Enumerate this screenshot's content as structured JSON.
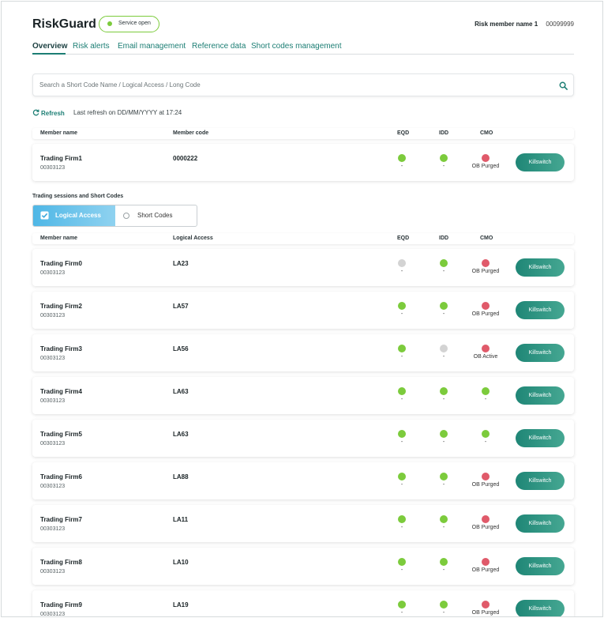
{
  "header": {
    "brand": "RiskGuard",
    "service_status": "Service open",
    "member_name": "Risk member name 1",
    "member_code": "00099999"
  },
  "colors": {
    "accent": "#1c7e74",
    "status_green": "#7ccb3c",
    "status_grey": "#d3d3d3",
    "status_red": "#e05a6a",
    "toggle_blue": "#4fb7e6"
  },
  "tabs": [
    "Overview",
    "Risk alerts",
    "Email management",
    "Reference data",
    "Short codes management"
  ],
  "search": {
    "placeholder": "Search a Short Code Name / Logical Access / Long Code",
    "icon": "search-icon"
  },
  "refresh": {
    "label": "Refresh",
    "last_refresh": "Last refresh on DD/MM/YYYY at 17:24"
  },
  "member_table": {
    "headers": {
      "name": "Member name",
      "code": "Member code",
      "eqd": "EQD",
      "idd": "IDD",
      "cmo": "CMO"
    },
    "rows": [
      {
        "name": "Trading Firm1",
        "sub": "00303123",
        "code": "0000222",
        "eqd": {
          "status": "green",
          "label": "-"
        },
        "idd": {
          "status": "green",
          "label": "-"
        },
        "cmo": {
          "status": "red",
          "label": "OB Purged"
        },
        "button": "Killswitch"
      }
    ]
  },
  "section_label": "Trading sessions and Short Codes",
  "toggle": {
    "options": [
      "Logical Access",
      "Short Codes"
    ],
    "selected": "Logical Access"
  },
  "la_table": {
    "headers": {
      "name": "Member name",
      "code": "Logical Access",
      "eqd": "EQD",
      "idd": "IDD",
      "cmo": "CMO"
    },
    "rows": [
      {
        "name": "Trading Firm0",
        "sub": "00303123",
        "code": "LA23",
        "eqd": {
          "status": "grey",
          "label": "-"
        },
        "idd": {
          "status": "green",
          "label": "-"
        },
        "cmo": {
          "status": "red",
          "label": "OB Purged"
        },
        "button": "Killswitch"
      },
      {
        "name": "Trading Firm2",
        "sub": "00303123",
        "code": "LA57",
        "eqd": {
          "status": "green",
          "label": "-"
        },
        "idd": {
          "status": "green",
          "label": "-"
        },
        "cmo": {
          "status": "red",
          "label": "OB Purged"
        },
        "button": "Killswitch"
      },
      {
        "name": "Trading Firm3",
        "sub": "00303123",
        "code": "LA56",
        "eqd": {
          "status": "green",
          "label": "-"
        },
        "idd": {
          "status": "grey",
          "label": "-"
        },
        "cmo": {
          "status": "red",
          "label": "OB Active"
        },
        "button": "Killswitch"
      },
      {
        "name": "Trading Firm4",
        "sub": "00303123",
        "code": "LA63",
        "eqd": {
          "status": "green",
          "label": "-"
        },
        "idd": {
          "status": "green",
          "label": "-"
        },
        "cmo": {
          "status": "green",
          "label": "-"
        },
        "button": "Killswitch"
      },
      {
        "name": "Trading Firm5",
        "sub": "00303123",
        "code": "LA63",
        "eqd": {
          "status": "green",
          "label": "-"
        },
        "idd": {
          "status": "green",
          "label": "-"
        },
        "cmo": {
          "status": "green",
          "label": "-"
        },
        "button": "Killswitch"
      },
      {
        "name": "Trading Firm6",
        "sub": "00303123",
        "code": "LA88",
        "eqd": {
          "status": "green",
          "label": "-"
        },
        "idd": {
          "status": "green",
          "label": "-"
        },
        "cmo": {
          "status": "red",
          "label": "OB Purged"
        },
        "button": "Killswitch"
      },
      {
        "name": "Trading Firm7",
        "sub": "00303123",
        "code": "LA11",
        "eqd": {
          "status": "green",
          "label": "-"
        },
        "idd": {
          "status": "green",
          "label": "-"
        },
        "cmo": {
          "status": "red",
          "label": "OB Purged"
        },
        "button": "Killswitch"
      },
      {
        "name": "Trading Firm8",
        "sub": "00303123",
        "code": "LA10",
        "eqd": {
          "status": "green",
          "label": "-"
        },
        "idd": {
          "status": "green",
          "label": "-"
        },
        "cmo": {
          "status": "red",
          "label": "OB Purged"
        },
        "button": "Killswitch"
      },
      {
        "name": "Trading Firm9",
        "sub": "00303123",
        "code": "LA19",
        "eqd": {
          "status": "green",
          "label": "-"
        },
        "idd": {
          "status": "green",
          "label": "-"
        },
        "cmo": {
          "status": "red",
          "label": "OB Purged"
        },
        "button": "Killswitch"
      }
    ]
  }
}
